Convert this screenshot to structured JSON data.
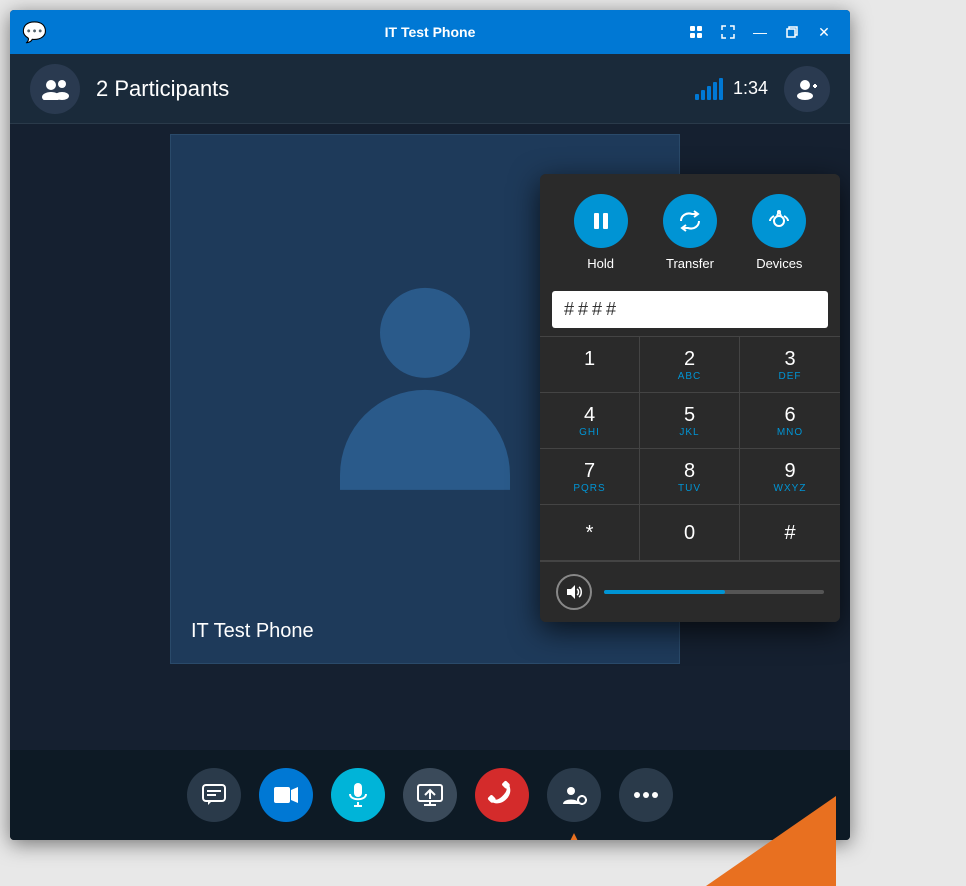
{
  "window": {
    "title": "IT Test Phone",
    "icon": "💬"
  },
  "titlebar": {
    "controls": {
      "skype_icon": "S",
      "maximize_icon": "⤢",
      "minimize_icon": "—",
      "restore_icon": "❐",
      "close_icon": "✕"
    }
  },
  "header": {
    "participants_count": "2 Participants",
    "timer": "1:34",
    "signal_bars": [
      6,
      10,
      14,
      18,
      22
    ]
  },
  "call": {
    "name": "IT Test Phone"
  },
  "dialpad": {
    "input_value": "####",
    "input_placeholder": "",
    "buttons": {
      "hold_label": "Hold",
      "transfer_label": "Transfer",
      "devices_label": "Devices"
    },
    "keys": [
      {
        "number": "1",
        "letters": ""
      },
      {
        "number": "2",
        "letters": "ABC"
      },
      {
        "number": "3",
        "letters": "DEF"
      },
      {
        "number": "4",
        "letters": "GHI"
      },
      {
        "number": "5",
        "letters": "JKL"
      },
      {
        "number": "6",
        "letters": "MNO"
      },
      {
        "number": "7",
        "letters": "PQRS"
      },
      {
        "number": "8",
        "letters": "TUV"
      },
      {
        "number": "9",
        "letters": "WXYZ"
      },
      {
        "number": "*",
        "letters": ""
      },
      {
        "number": "0",
        "letters": ""
      },
      {
        "number": "#",
        "letters": ""
      }
    ],
    "volume_percent": 55
  },
  "toolbar": {
    "buttons": [
      {
        "id": "chat",
        "icon": "💬",
        "type": "dark"
      },
      {
        "id": "video",
        "icon": "📹",
        "type": "blue"
      },
      {
        "id": "mic",
        "icon": "🎤",
        "type": "cyan"
      },
      {
        "id": "screen",
        "icon": "🖥",
        "type": "gray"
      },
      {
        "id": "hangup",
        "icon": "📞",
        "type": "red"
      },
      {
        "id": "person-gear",
        "icon": "👤⚙",
        "type": "person-gear"
      },
      {
        "id": "more",
        "icon": "•••",
        "type": "dots"
      }
    ]
  },
  "colors": {
    "accent_blue": "#0094d4",
    "background_dark": "#1a2a3a",
    "titlebar_blue": "#0078d4",
    "hang_up_red": "#d42b2b",
    "orange": "#e87020"
  }
}
